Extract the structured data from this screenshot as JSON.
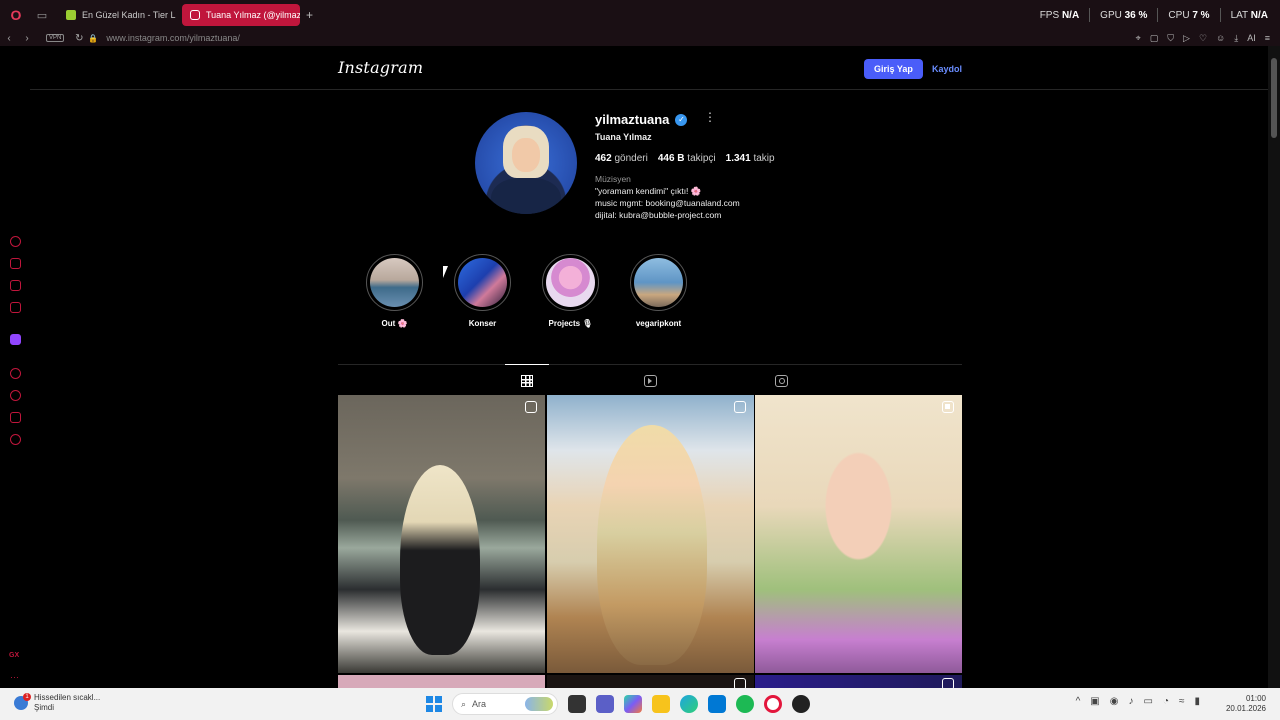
{
  "browser": {
    "tabs": [
      {
        "label": "En Güzel Kadın - Tier List",
        "active": false
      },
      {
        "label": "Tuana Yılmaz (@yilmaztuana",
        "active": true
      }
    ],
    "stats": {
      "fps_label": "FPS",
      "fps": "N/A",
      "gpu_label": "GPU",
      "gpu": "36 %",
      "cpu_label": "CPU",
      "cpu": "7 %",
      "lat_label": "LAT",
      "lat": "N/A"
    },
    "vpn": "VPN",
    "url_host": "www.instagram.com",
    "url_path": "/yilmaztuana/",
    "toolbar_ai": "AI"
  },
  "instagram": {
    "logo": "Instagram",
    "login_label": "Giriş Yap",
    "signup_label": "Kaydol",
    "profile": {
      "username": "yilmaztuana",
      "full_name": "Tuana Yılmaz",
      "posts_count": "462",
      "posts_label": "gönderi",
      "followers_count": "446 B",
      "followers_label": "takipçi",
      "following_count": "1.341",
      "following_label": "takip",
      "category": "Müzisyen",
      "bio_line1": "\"yoramam kendimi\" çıktı! 🌸",
      "bio_line2": "music mgmt: booking@tuanaland.com",
      "bio_line3": "dijital: kubra@bubble-project.com"
    },
    "highlights": [
      {
        "label": "Out 🌸"
      },
      {
        "label": "Konser"
      },
      {
        "label": "Projects 🎙"
      },
      {
        "label": "vegaripkont"
      }
    ]
  },
  "taskbar": {
    "weather_line1": "Hissedilen sıcakl...",
    "weather_line2": "Şimdi",
    "search_placeholder": "Ara",
    "time": "01:00",
    "date": "20.01.2026"
  }
}
